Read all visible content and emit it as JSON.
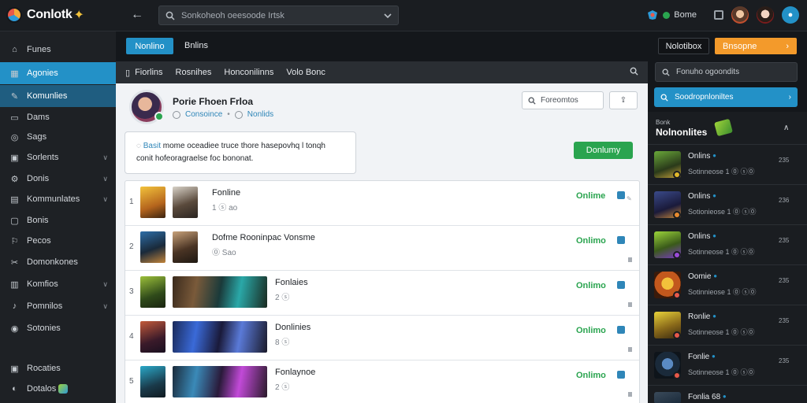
{
  "app": {
    "name": "Conlotk"
  },
  "topbar": {
    "search_placeholder": "Sonkoheoh oeesoode Irtsk",
    "profile_label": "Bome"
  },
  "sidebar": {
    "items": [
      {
        "label": "Funes",
        "icon": "home-icon"
      },
      {
        "label": "Agonies",
        "icon": "grid-icon"
      },
      {
        "label": "Komunlies",
        "icon": "pencil-icon"
      },
      {
        "label": "Dams",
        "icon": "folder-icon"
      },
      {
        "label": "Sags",
        "icon": "gamepad-icon"
      },
      {
        "label": "Sorlents",
        "icon": "trophy-icon"
      },
      {
        "label": "Donis",
        "icon": "gear-icon"
      },
      {
        "label": "Kommunlates",
        "icon": "users-icon"
      },
      {
        "label": "Bonis",
        "icon": "mail-icon"
      },
      {
        "label": "Pecos",
        "icon": "star-icon"
      },
      {
        "label": "Domonkones",
        "icon": "link-icon"
      },
      {
        "label": "Komfios",
        "icon": "flag-icon"
      },
      {
        "label": "Pomnilos",
        "icon": "bell-icon"
      },
      {
        "label": "Sotonies",
        "icon": "clock-icon"
      }
    ],
    "bottom": [
      {
        "label": "Rocaties",
        "icon": "chat-icon"
      },
      {
        "label": "Dotalos",
        "icon": "info-icon"
      }
    ]
  },
  "main": {
    "new_button": "Nonlino",
    "online_heading": "Bnlins",
    "tabs": [
      "Fiorlins",
      "Rosnihes",
      "Honconilinns",
      "Volo Bonc"
    ],
    "profile": {
      "name": "Porie Fhoen Frloa",
      "meta_left": "Consoince",
      "meta_right": "Nonlids"
    },
    "find_placeholder": "Foreomtos",
    "notice": {
      "link": "Basit",
      "text_line1": "mome oceadiee truce thore hasepovhq l tonqh",
      "text_line2": "conit hofeoragraelse foc bononat."
    },
    "join_button": "Donlumy",
    "rows": [
      {
        "num": "1",
        "title": "Fonline",
        "sub": "1 ⓢ ao",
        "status": "Onlime"
      },
      {
        "num": "2",
        "title": "Dofme Rooninpac Vonsme",
        "sub": "⓪ Sao",
        "status": "Onlimo"
      },
      {
        "num": "3",
        "title": "Fonlaies",
        "sub": "2 ⓢ",
        "status": "Onlimo"
      },
      {
        "num": "4",
        "title": "Donlinies",
        "sub": "8 ⓢ",
        "status": "Onlimo"
      },
      {
        "num": "5",
        "title": "Fonlaynoe",
        "sub": "2 ⓢ",
        "status": "Onlimo"
      }
    ]
  },
  "right": {
    "notify_button": "Nolotibox",
    "orange_button": "Bnsopne",
    "search_placeholder": "Fonuho ogoondits",
    "filter_button": "Soodropnloniltes",
    "kicker": "Bonk",
    "title": "Nolnonlites",
    "friends": [
      {
        "name": "Onlins",
        "status": "Sotinneose 1 ⓪ ⓢ⓪",
        "count": "235",
        "dot": "#e0b72a"
      },
      {
        "name": "Onlins",
        "status": "Sotionieose 1 ⓪ ⓢ⓪",
        "count": "236",
        "dot": "#e88a2e"
      },
      {
        "name": "Onlins",
        "status": "Sotinneose 1 ⓪ ⓢ⓪",
        "count": "235",
        "dot": "#9a4ad8"
      },
      {
        "name": "Oomie",
        "status": "Sotinnieose 1 ⓪ ⓢ⓪",
        "count": "235",
        "dot": "#e8594a"
      },
      {
        "name": "Ronlie",
        "status": "Sotinneose 1 ⓪ ⓢ⓪",
        "count": "235",
        "dot": "#e8594a"
      },
      {
        "name": "Fonlie",
        "status": "Sotinneose 1 ⓪ ⓢ⓪",
        "count": "235",
        "dot": "#e8594a"
      },
      {
        "name": "Fonlia 68",
        "status": "",
        "count": "",
        "dot": "#2391c7"
      }
    ]
  },
  "colors": {
    "accent": "#2391c7",
    "online": "#2aa44f",
    "orange": "#f39a2b"
  }
}
